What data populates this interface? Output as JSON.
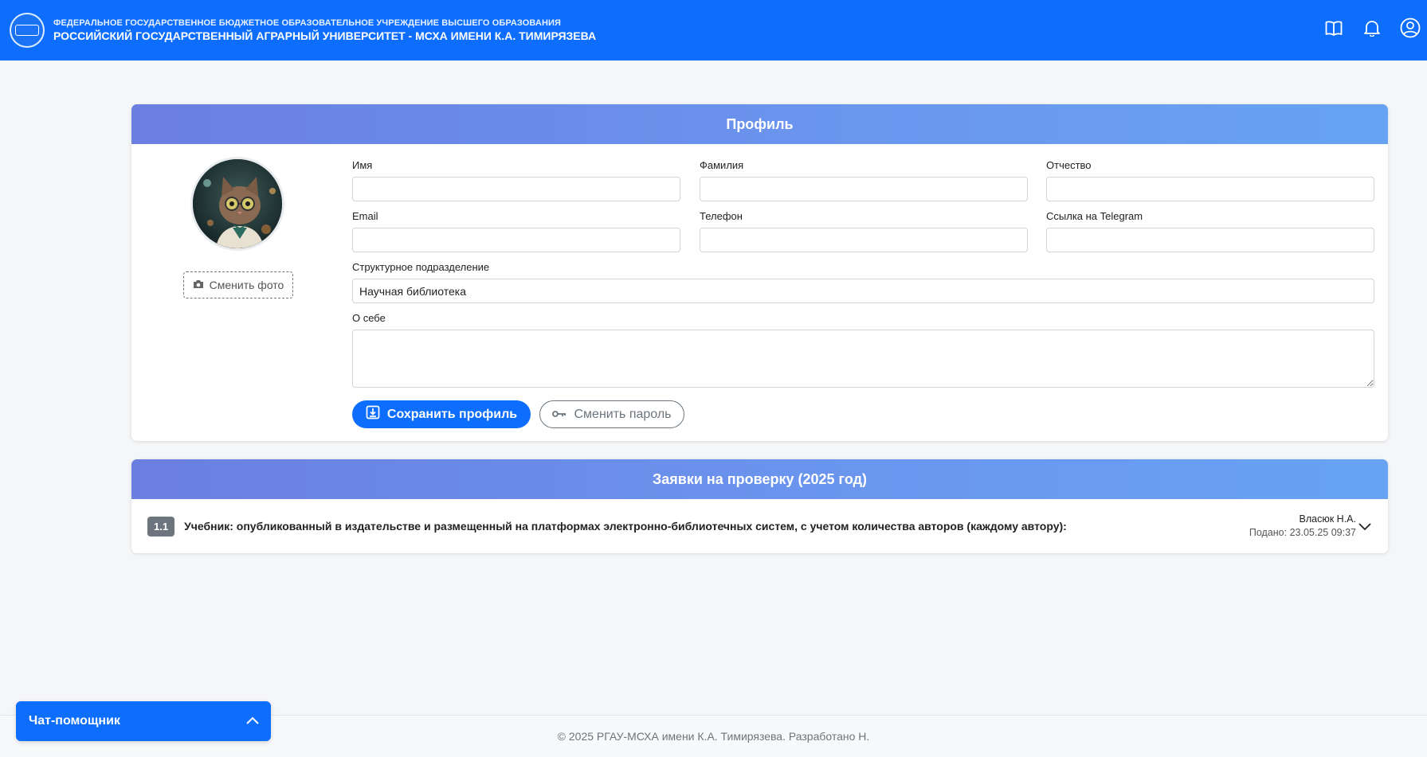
{
  "header": {
    "subtitle": "ФЕДЕРАЛЬНОЕ ГОСУДАРСТВЕННОЕ БЮДЖЕТНОЕ ОБРАЗОВАТЕЛЬНОЕ УЧРЕЖДЕНИЕ ВЫСШЕГО ОБРАЗОВАНИЯ",
    "title": "РОССИЙСКИЙ ГОСУДАРСТВЕННЫЙ АГРАРНЫЙ УНИВЕРСИТЕТ - МСХА ИМЕНИ К.А. ТИМИРЯЗЕВА",
    "icons": [
      "book-icon",
      "bell-icon",
      "user-circle-icon"
    ]
  },
  "profile": {
    "heading": "Профиль",
    "change_photo_label": "Сменить фото",
    "fields": {
      "first_name": {
        "label": "Имя",
        "value": ""
      },
      "last_name": {
        "label": "Фамилия",
        "value": ""
      },
      "patronymic": {
        "label": "Отчество",
        "value": ""
      },
      "email": {
        "label": "Email",
        "value": ""
      },
      "phone": {
        "label": "Телефон",
        "value": ""
      },
      "telegram": {
        "label": "Ссылка на Telegram",
        "value": ""
      },
      "department": {
        "label": "Структурное подразделение",
        "value": "Научная библиотека"
      },
      "about": {
        "label": "О себе",
        "value": ""
      }
    },
    "save_label": "Сохранить профиль",
    "change_password_label": "Сменить пароль"
  },
  "requests": {
    "heading": "Заявки на проверку (2025 год)",
    "items": [
      {
        "number": "1.1",
        "title": "Учебник: опубликованный в издательстве и размещенный на платформах электронно-библиотечных систем, с учетом количества авторов (каждому автору):",
        "author": "Власюк Н.А.",
        "submitted": "Подано: 23.05.25 09:37"
      }
    ]
  },
  "footer": {
    "text": "© 2025 РГАУ-МСХА имени К.А. Тимирязева. Разработано Н."
  },
  "chat": {
    "label": "Чат-помощник"
  },
  "colors": {
    "primary": "#0d6efd",
    "header_gradient_start": "#6b7fe0",
    "header_gradient_end": "#68a3f3",
    "badge": "#6c757d"
  }
}
